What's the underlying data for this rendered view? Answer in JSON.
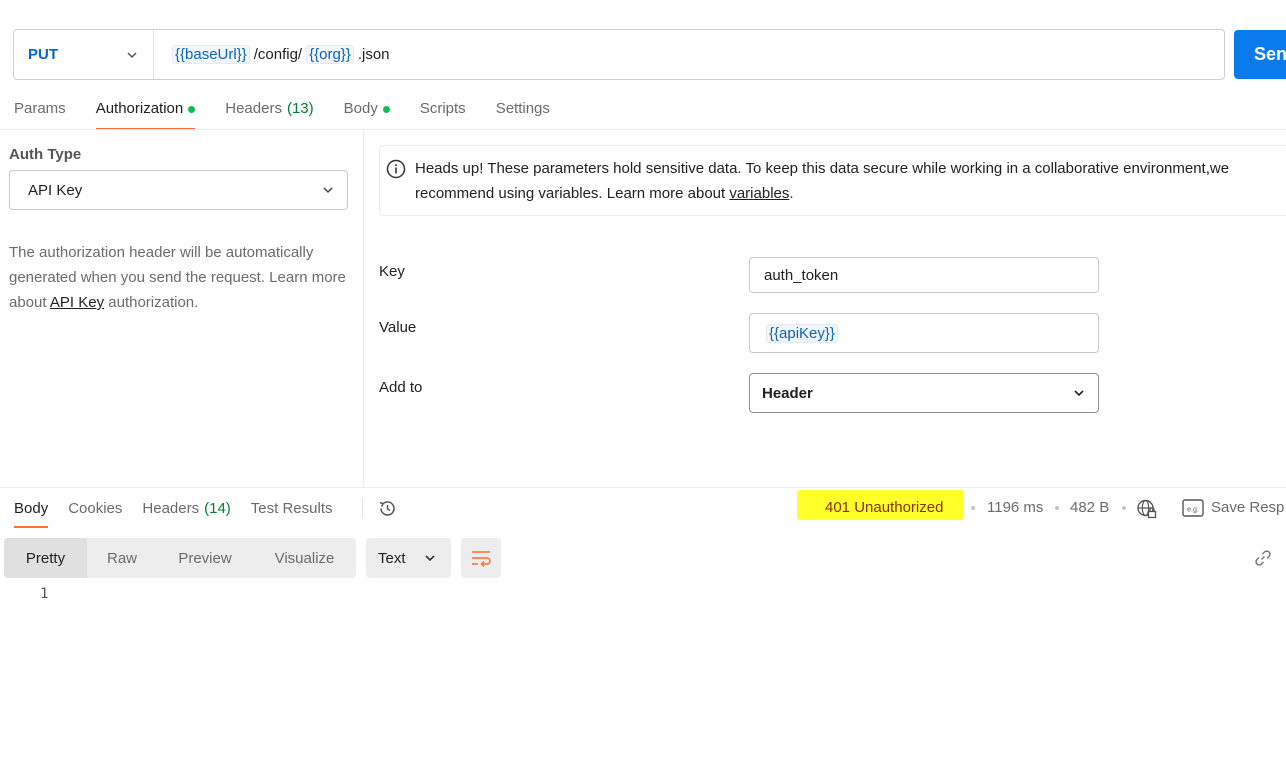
{
  "request": {
    "method": "PUT",
    "url": {
      "var1": "{{baseUrl}}",
      "path": "/config/",
      "var2": "{{org}}",
      "ext": ".json"
    },
    "send_label": "Sen"
  },
  "request_tabs": [
    {
      "label": "Params"
    },
    {
      "label": "Authorization"
    },
    {
      "label": "Headers",
      "count": "(13)"
    },
    {
      "label": "Body"
    },
    {
      "label": "Scripts"
    },
    {
      "label": "Settings"
    }
  ],
  "auth": {
    "type_label": "Auth Type",
    "type_value": "API Key",
    "desc_prefix": "The authorization header will be automatically generated when you send the request. Learn more about ",
    "desc_link": "API Key",
    "desc_suffix": " authorization."
  },
  "notice": {
    "text": "Heads up! These parameters hold sensitive data. To keep this data secure while working in a collaborative environment,we recommend using variables. Learn more about ",
    "link": "variables",
    "end": "."
  },
  "fields": {
    "key_label": "Key",
    "key_value": "auth_token",
    "value_label": "Value",
    "value_value": "{{apiKey}}",
    "addto_label": "Add to",
    "addto_value": "Header"
  },
  "response_tabs": [
    {
      "label": "Body"
    },
    {
      "label": "Cookies"
    },
    {
      "label": "Headers",
      "count": "(14)"
    },
    {
      "label": "Test Results"
    }
  ],
  "response_meta": {
    "status": "401 Unauthorized",
    "time": "1196 ms",
    "size": "482 B",
    "save_label": "Save Resp"
  },
  "view_modes": [
    "Pretty",
    "Raw",
    "Preview",
    "Visualize"
  ],
  "format": "Text",
  "line_number": "1",
  "colors": {
    "accent": "#ff6c37",
    "method": "#0265d2",
    "send": "#097bed",
    "status_highlight": "#ffff2a",
    "dot": "#0cbb52"
  }
}
